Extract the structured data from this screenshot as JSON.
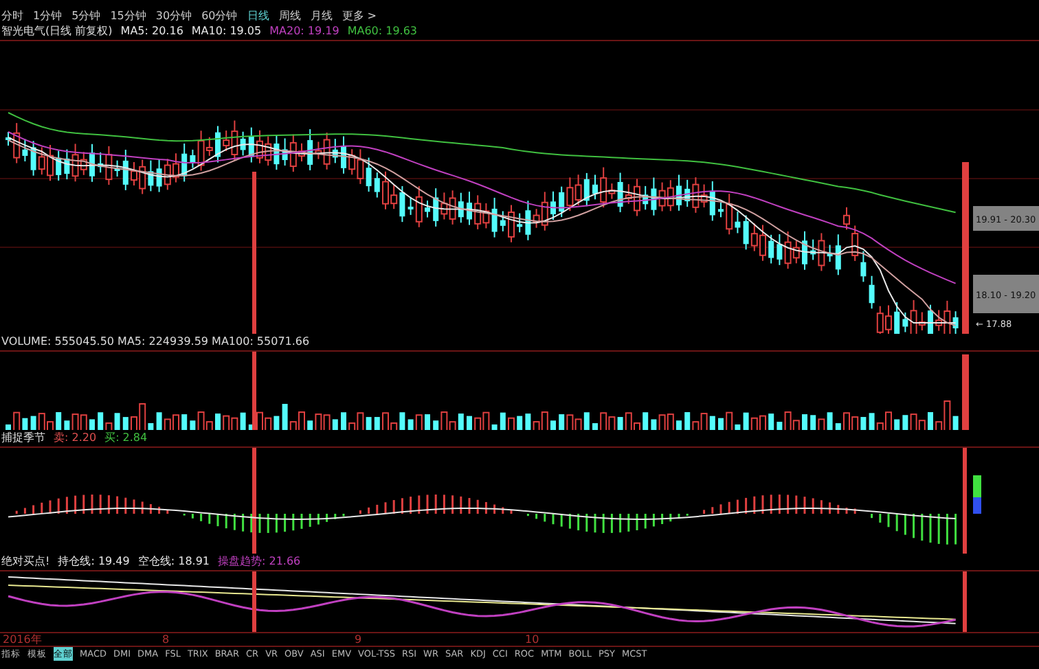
{
  "period_tabs": [
    {
      "label": "分时",
      "selected": false
    },
    {
      "label": "1分钟",
      "selected": false
    },
    {
      "label": "5分钟",
      "selected": false
    },
    {
      "label": "15分钟",
      "selected": false
    },
    {
      "label": "30分钟",
      "selected": false
    },
    {
      "label": "60分钟",
      "selected": false
    },
    {
      "label": "日线",
      "selected": true
    },
    {
      "label": "周线",
      "selected": false
    },
    {
      "label": "月线",
      "selected": false
    },
    {
      "label": "更多 >",
      "selected": false
    }
  ],
  "price_panel": {
    "title": "智光电气(日线 前复权)",
    "legend": [
      {
        "text": "MA5: 20.16",
        "color": "#e8e8e8"
      },
      {
        "text": "MA10: 19.05",
        "color": "#e8e8e8"
      },
      {
        "text": "MA20: 19.19",
        "color": "#c040c0"
      },
      {
        "text": "MA60: 19.63",
        "color": "#40c040"
      }
    ],
    "range_labels": [
      "19.91 - 20.30",
      "18.10 - 19.20",
      "← 17.88"
    ]
  },
  "volume_panel": {
    "legend": "VOLUME: 555045.50 MA5: 224939.59 MA100: 55071.66"
  },
  "macd_panel": {
    "title": "捕捉季节",
    "legend": [
      {
        "text": "卖: 2.20",
        "color": "#e05050"
      },
      {
        "text": "买: 2.84",
        "color": "#40c040"
      }
    ]
  },
  "signal_panel": {
    "title": "绝对买点!",
    "legend": [
      {
        "text": "持仓线: 19.49",
        "color": "#e8e8e8"
      },
      {
        "text": "空仓线: 18.91",
        "color": "#e8e8e8"
      },
      {
        "text": "操盘趋势: 21.66",
        "color": "#c040c0"
      }
    ]
  },
  "date_axis": [
    "2016年",
    "8",
    "9",
    "10"
  ],
  "indicator_tabs": [
    {
      "label": "指标",
      "selected": false
    },
    {
      "label": "模板",
      "selected": false
    },
    {
      "label": "全部",
      "selected": true
    },
    {
      "label": "MACD",
      "selected": false
    },
    {
      "label": "DMI",
      "selected": false
    },
    {
      "label": "DMA",
      "selected": false
    },
    {
      "label": "FSL",
      "selected": false
    },
    {
      "label": "TRIX",
      "selected": false
    },
    {
      "label": "BRAR",
      "selected": false
    },
    {
      "label": "CR",
      "selected": false
    },
    {
      "label": "VR",
      "selected": false
    },
    {
      "label": "OBV",
      "selected": false
    },
    {
      "label": "ASI",
      "selected": false
    },
    {
      "label": "EMV",
      "selected": false
    },
    {
      "label": "VOL-TSS",
      "selected": false
    },
    {
      "label": "RSI",
      "selected": false
    },
    {
      "label": "WR",
      "selected": false
    },
    {
      "label": "SAR",
      "selected": false
    },
    {
      "label": "KDJ",
      "selected": false
    },
    {
      "label": "CCI",
      "selected": false
    },
    {
      "label": "ROC",
      "selected": false
    },
    {
      "label": "MTM",
      "selected": false
    },
    {
      "label": "BOLL",
      "selected": false
    },
    {
      "label": "PSY",
      "selected": false
    },
    {
      "label": "MCST",
      "selected": false
    }
  ]
}
